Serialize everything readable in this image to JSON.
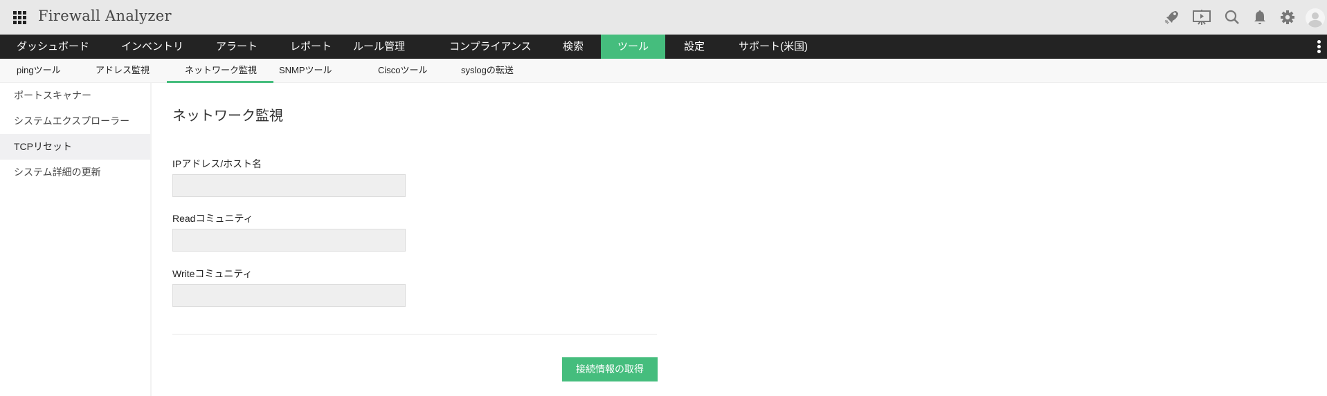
{
  "header": {
    "title": "Firewall Analyzer",
    "icons": [
      "apps-grid-icon",
      "rocket-icon",
      "presentation-icon",
      "search-icon",
      "bell-icon",
      "gear-icon",
      "avatar-icon"
    ]
  },
  "nav": {
    "items": [
      "ダッシュボード",
      "インベントリ",
      "アラート",
      "レポート",
      "ルール管理",
      "コンプライアンス",
      "検索",
      "ツール",
      "設定",
      "サポート(米国)"
    ],
    "active": "ツール"
  },
  "subnav": {
    "items": [
      "pingツール",
      "アドレス監視",
      "ネットワーク監視",
      "SNMPツール",
      "Ciscoツール",
      "syslogの転送"
    ],
    "active": "ネットワーク監視"
  },
  "sidebar": {
    "items": [
      "ポートスキャナー",
      "システムエクスプローラー",
      "TCPリセット",
      "システム詳細の更新"
    ],
    "active": "TCPリセット"
  },
  "main": {
    "title": "ネットワーク監視",
    "fields": [
      {
        "label": "IPアドレス/ホスト名",
        "value": ""
      },
      {
        "label": "Readコミュニティ",
        "value": ""
      },
      {
        "label": "Writeコミュニティ",
        "value": ""
      }
    ],
    "submit_label": "接続情報の取得"
  },
  "colors": {
    "accent": "#45bd7d",
    "nav_bg": "#232323",
    "header_bg": "#e8e8e8"
  }
}
